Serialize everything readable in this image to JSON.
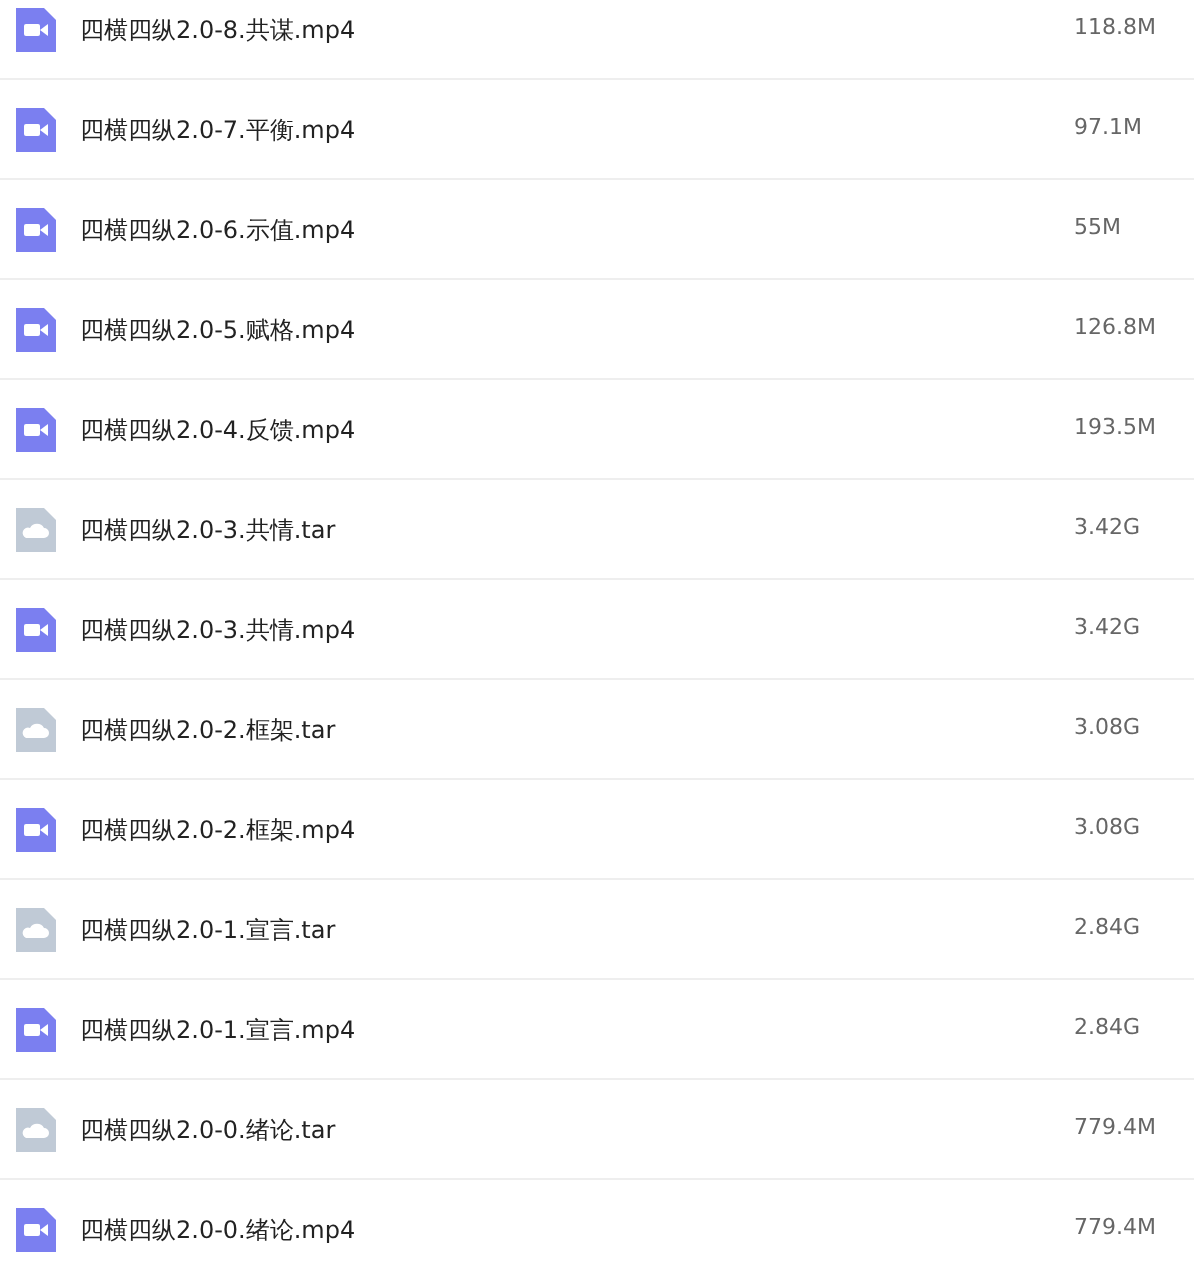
{
  "files": [
    {
      "kind": "video",
      "name": "四横四纵2.0-8.共谋.mp4",
      "size": "118.8M"
    },
    {
      "kind": "video",
      "name": "四横四纵2.0-7.平衡.mp4",
      "size": "97.1M"
    },
    {
      "kind": "video",
      "name": "四横四纵2.0-6.示值.mp4",
      "size": "55M"
    },
    {
      "kind": "video",
      "name": "四横四纵2.0-5.赋格.mp4",
      "size": "126.8M"
    },
    {
      "kind": "video",
      "name": "四横四纵2.0-4.反馈.mp4",
      "size": "193.5M"
    },
    {
      "kind": "archive",
      "name": "四横四纵2.0-3.共情.tar",
      "size": "3.42G"
    },
    {
      "kind": "video",
      "name": "四横四纵2.0-3.共情.mp4",
      "size": "3.42G"
    },
    {
      "kind": "archive",
      "name": "四横四纵2.0-2.框架.tar",
      "size": "3.08G"
    },
    {
      "kind": "video",
      "name": "四横四纵2.0-2.框架.mp4",
      "size": "3.08G"
    },
    {
      "kind": "archive",
      "name": "四横四纵2.0-1.宣言.tar",
      "size": "2.84G"
    },
    {
      "kind": "video",
      "name": "四横四纵2.0-1.宣言.mp4",
      "size": "2.84G"
    },
    {
      "kind": "archive",
      "name": "四横四纵2.0-0.绪论.tar",
      "size": "779.4M"
    },
    {
      "kind": "video",
      "name": "四横四纵2.0-0.绪论.mp4",
      "size": "779.4M"
    }
  ]
}
